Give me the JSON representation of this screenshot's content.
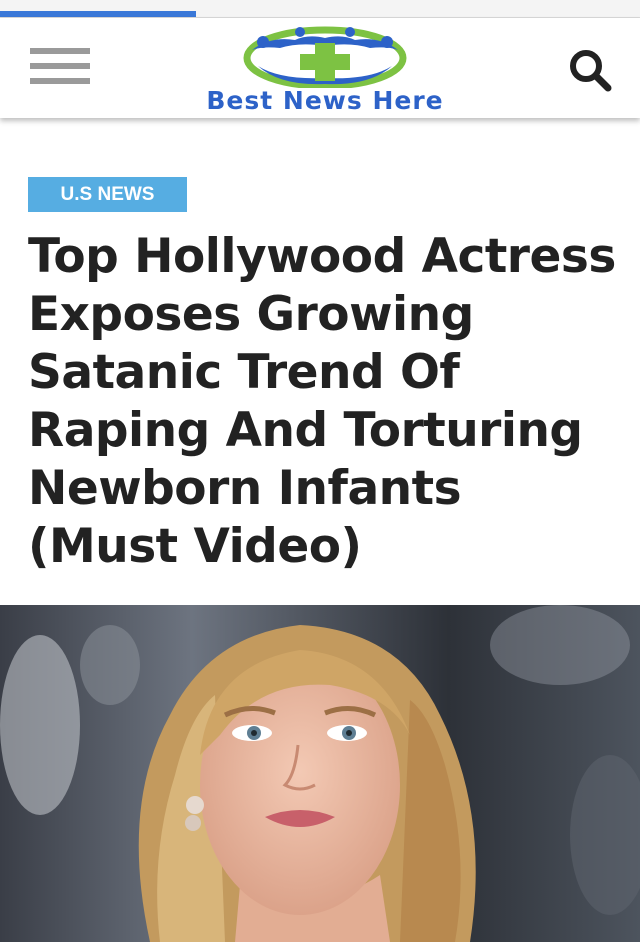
{
  "header": {
    "logo_text": "Best News Here",
    "menu_icon": "hamburger-menu-icon",
    "search_icon": "search-icon"
  },
  "article": {
    "category": "U.S NEWS",
    "title": "Top Hollywood Actress Exposes Growing Satanic Trend Of Raping And Torturing Newborn Infants (Must Video)"
  },
  "colors": {
    "progress": "#3a78d8",
    "category_bg": "#56ade2",
    "logo_blue": "#2d62c8",
    "logo_green": "#7dc243"
  }
}
